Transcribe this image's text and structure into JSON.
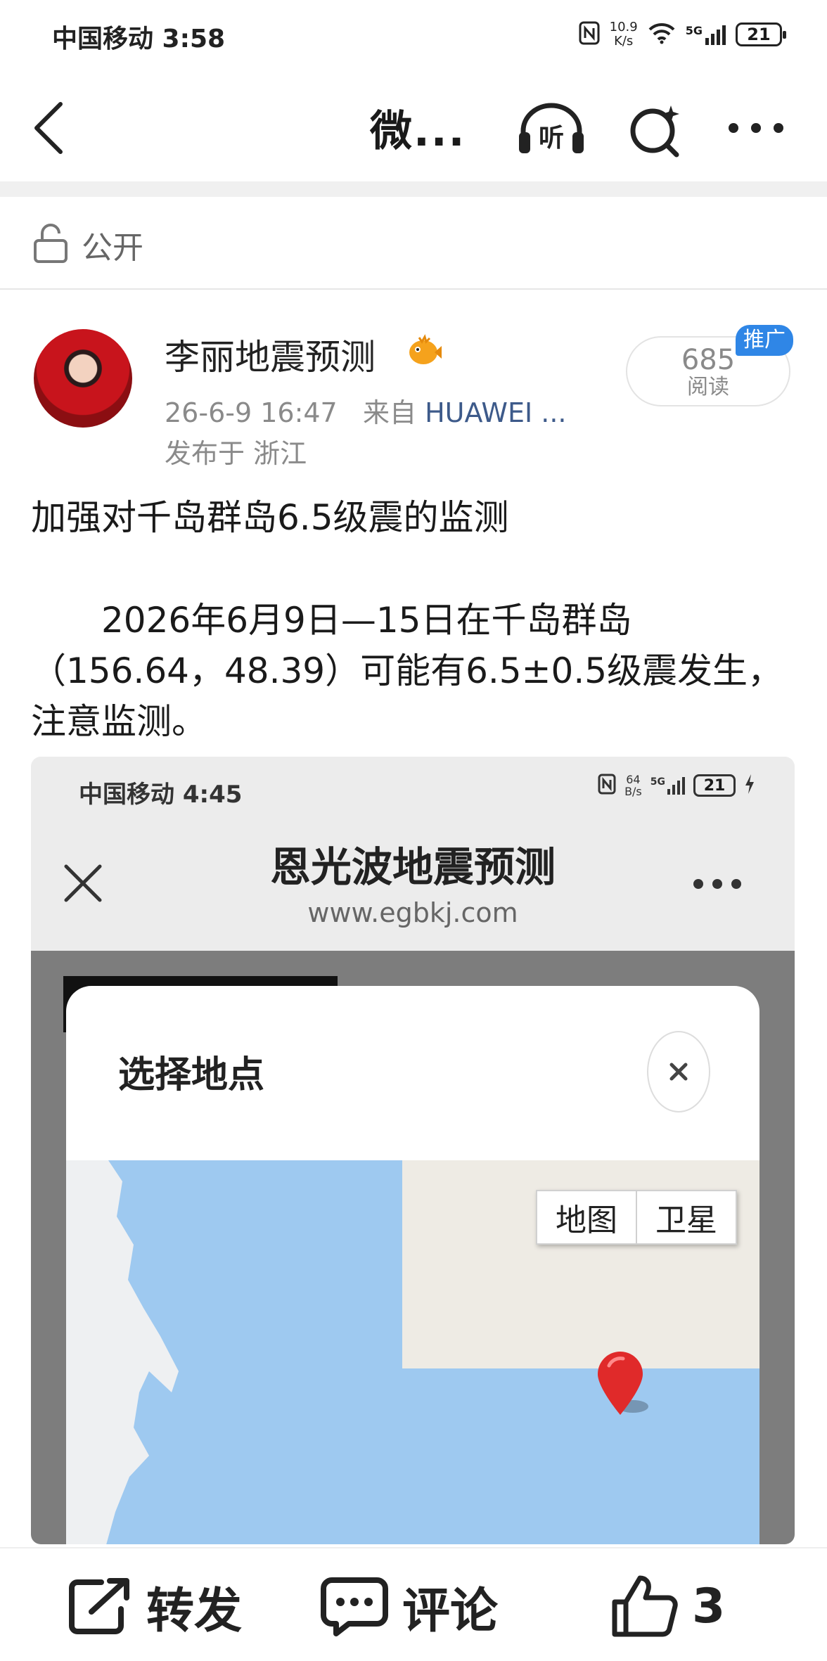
{
  "status_bar": {
    "carrier_time": "中国移动 3:58",
    "net_speed_value": "10.9",
    "net_speed_unit": "K/s",
    "signal_label": "5G",
    "battery": "21"
  },
  "nav": {
    "title": "微..."
  },
  "visibility": {
    "label": "公开"
  },
  "post": {
    "author": "李丽地震预测",
    "timestamp": "26-6-9 16:47",
    "source_prefix": "来自",
    "source": "HUAWEI ...",
    "location": "发布于 浙江",
    "reads_count": "685",
    "reads_label": "阅读",
    "promo_tag": "推广",
    "headline": "加强对千岛群岛6.5级震的监测",
    "body": "　　2026年6月9日—15日在千岛群岛（156.64，48.39）可能有6.5±0.5级震发生，注意监测。"
  },
  "embedded_screenshot": {
    "carrier_time": "中国移动 4:45",
    "net_speed_value": "64",
    "net_speed_unit": "B/s",
    "signal_label": "5G",
    "battery": "21",
    "title": "恩光波地震预测",
    "url": "www.egbkj.com",
    "dialog_title": "选择地点",
    "map_type_map": "地图",
    "map_type_satellite": "卫星"
  },
  "bottom_bar": {
    "repost_label": "转发",
    "comment_label": "评论",
    "like_count": "3"
  }
}
